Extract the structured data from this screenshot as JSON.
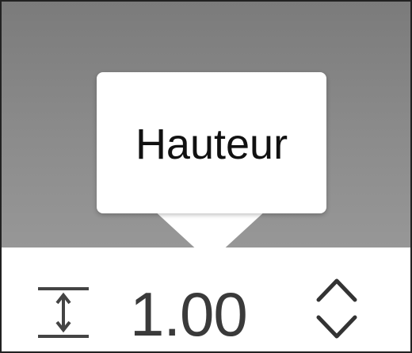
{
  "tooltip": {
    "label": "Hauteur"
  },
  "height_field": {
    "value": "1.00"
  },
  "icons": {
    "height": "height-spacing-icon",
    "increment": "chevron-up-icon",
    "decrement": "chevron-down-icon"
  },
  "colors": {
    "backdrop": "#8a8a8a",
    "tooltip_bg": "#ffffff",
    "text": "#111111",
    "value_text": "#3a3a3a"
  }
}
